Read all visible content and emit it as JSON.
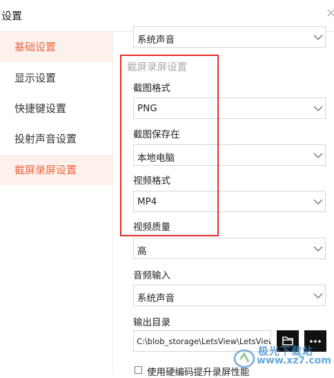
{
  "window": {
    "title": "设置",
    "close_glyph": "×"
  },
  "sidebar": {
    "items": [
      {
        "label": "基础设置",
        "selected": true
      },
      {
        "label": "显示设置",
        "selected": false
      },
      {
        "label": "快捷键设置",
        "selected": false
      },
      {
        "label": "投射声音设置",
        "selected": false
      },
      {
        "label": "截屏录屏设置",
        "selected": true
      }
    ]
  },
  "content": {
    "top_select_value": "系统声音",
    "section_title": "截屏录屏设置",
    "fields": [
      {
        "label": "截图格式",
        "value": "PNG"
      },
      {
        "label": "截图保存在",
        "value": "本地电脑"
      },
      {
        "label": "视频格式",
        "value": "MP4"
      },
      {
        "label": "视频质量",
        "value": "高"
      },
      {
        "label": "音频输入",
        "value": "系统声音"
      }
    ],
    "output_dir": {
      "label": "输出目录",
      "path": "C:\\blob_storage\\LetsView\\LetsView"
    },
    "checkbox_label": "使用硬编码提升录屏性能",
    "folder_glyph": "🗁",
    "more_glyph": "···"
  },
  "watermark": {
    "text": "极光下载站",
    "url": "www.xz7.com"
  },
  "colors": {
    "accent": "#f0663c",
    "highlight_border": "#e52a25",
    "selected_bg": "#fdf1ee"
  }
}
